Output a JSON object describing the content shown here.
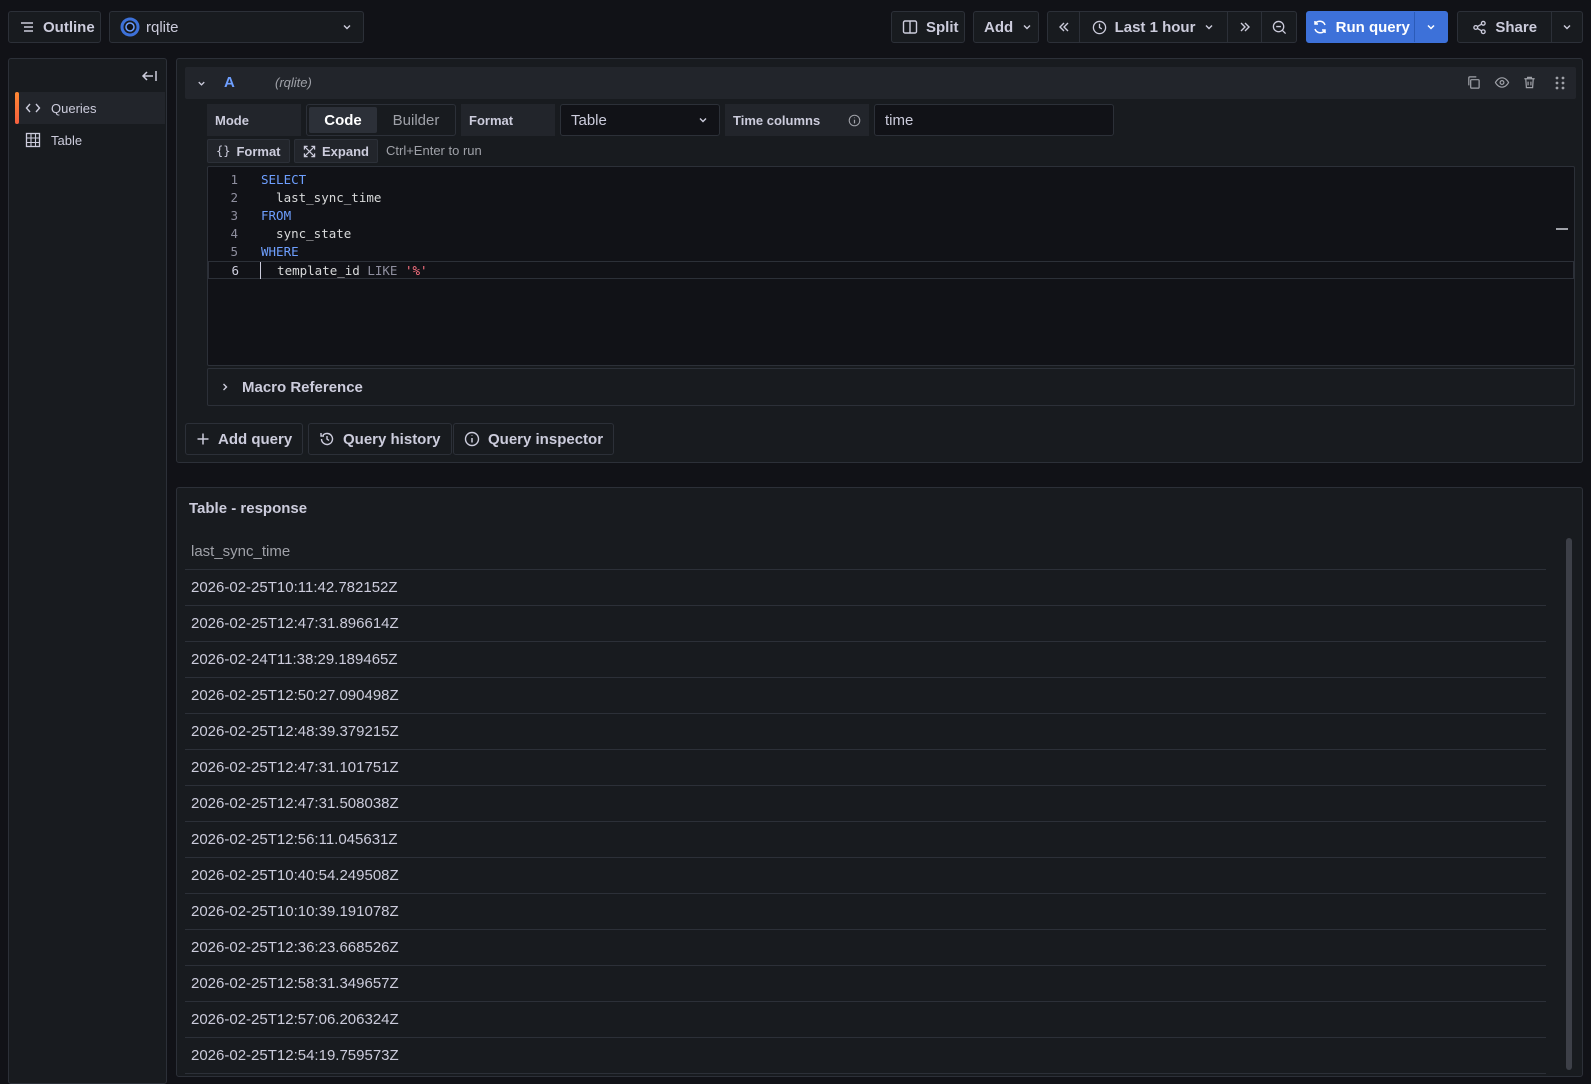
{
  "toolbar": {
    "outline_label": "Outline",
    "datasource_name": "rqlite",
    "split_label": "Split",
    "add_label": "Add",
    "time_range_label": "Last 1 hour",
    "run_query_label": "Run query",
    "share_label": "Share"
  },
  "sidebar": {
    "items": [
      {
        "label": "Queries",
        "icon": "code-icon",
        "active": true
      },
      {
        "label": "Table",
        "icon": "table-icon",
        "active": false
      }
    ]
  },
  "query": {
    "ref_id": "A",
    "datasource": "(rqlite)",
    "mode_label": "Mode",
    "mode_options": [
      "Code",
      "Builder"
    ],
    "mode_selected": "Code",
    "format_label": "Format",
    "format_value": "Table",
    "time_columns_label": "Time columns",
    "time_columns_value": "time",
    "format_button_label": "Format",
    "expand_button_label": "Expand",
    "run_hint": "Ctrl+Enter to run",
    "code_lines": [
      {
        "n": "1",
        "text": "SELECT"
      },
      {
        "n": "2",
        "text": "  last_sync_time"
      },
      {
        "n": "3",
        "text": "FROM"
      },
      {
        "n": "4",
        "text": "  sync_state"
      },
      {
        "n": "5",
        "text": "WHERE"
      },
      {
        "n": "6",
        "text": "  template_id LIKE '%'"
      }
    ],
    "macro_reference_label": "Macro Reference"
  },
  "actions": {
    "add_query_label": "Add query",
    "query_history_label": "Query history",
    "query_inspector_label": "Query inspector"
  },
  "results": {
    "title": "Table - response",
    "column_header": "last_sync_time",
    "rows": [
      "2026-02-25T10:11:42.782152Z",
      "2026-02-25T12:47:31.896614Z",
      "2026-02-24T11:38:29.189465Z",
      "2026-02-25T12:50:27.090498Z",
      "2026-02-25T12:48:39.379215Z",
      "2026-02-25T12:47:31.101751Z",
      "2026-02-25T12:47:31.508038Z",
      "2026-02-25T12:56:11.045631Z",
      "2026-02-25T10:40:54.249508Z",
      "2026-02-25T10:10:39.191078Z",
      "2026-02-25T12:36:23.668526Z",
      "2026-02-25T12:58:31.349657Z",
      "2026-02-25T12:57:06.206324Z",
      "2026-02-25T12:54:19.759573Z"
    ]
  },
  "colors": {
    "background": "#111217",
    "panel": "#181b1f",
    "border": "#2c3038",
    "primary": "#3d71d9",
    "accent": "#f55f3e",
    "keyword": "#6e9fff",
    "string": "#ff7383"
  }
}
